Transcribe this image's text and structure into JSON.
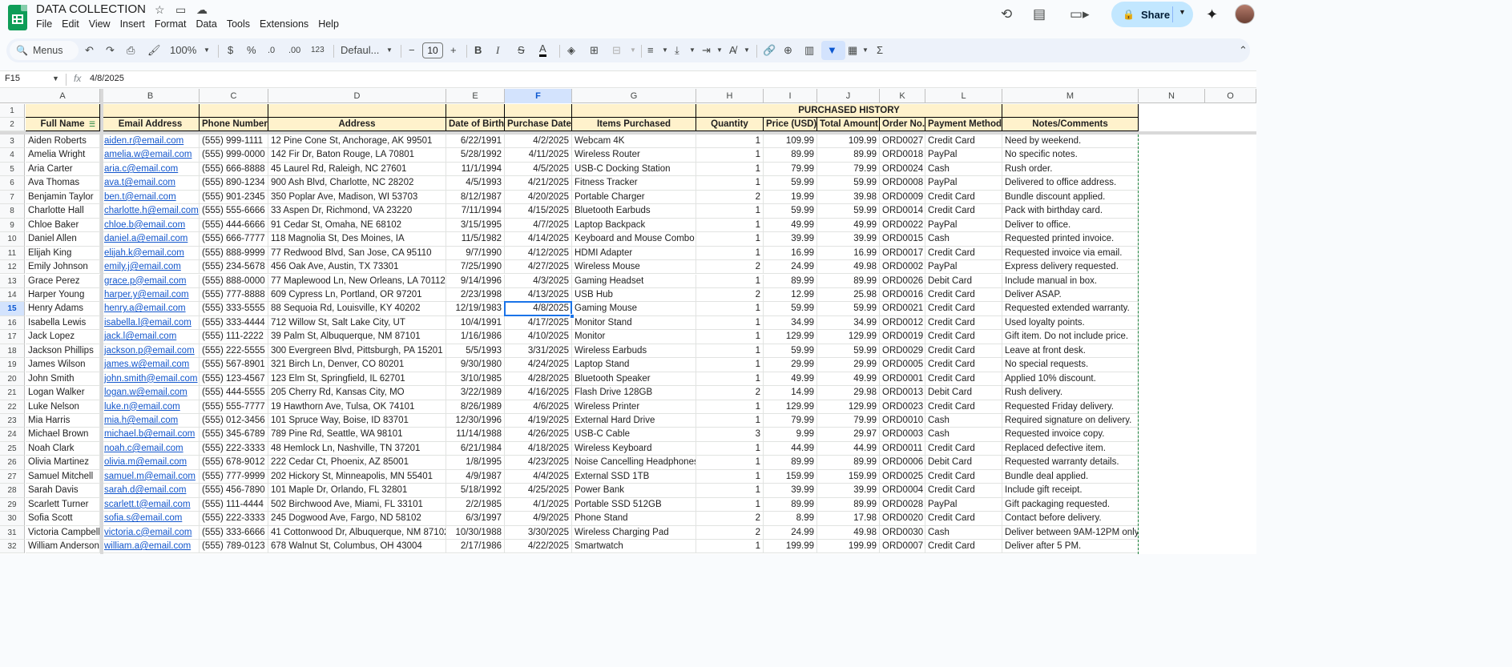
{
  "app": {
    "doc_title": "DATA COLLECTION",
    "menu": [
      "File",
      "Edit",
      "View",
      "Insert",
      "Format",
      "Data",
      "Tools",
      "Extensions",
      "Help"
    ],
    "share_label": "Share"
  },
  "toolbar": {
    "menus_label": "Menus",
    "zoom": "100%",
    "currency": "$",
    "percent": "%",
    "dec_less": ".0",
    "dec_more": ".00",
    "num_format": "123",
    "font": "Defaul...",
    "font_size": "10",
    "bold": "B",
    "italic": "I",
    "strike": "S",
    "text_color": "A"
  },
  "formula_bar": {
    "cell_ref": "F15",
    "fx": "fx",
    "value": "4/8/2025"
  },
  "columns": [
    "A",
    "B",
    "C",
    "D",
    "E",
    "F",
    "G",
    "H",
    "I",
    "J",
    "K",
    "L",
    "M",
    "N",
    "O"
  ],
  "selected_col": "F",
  "selected_row": 15,
  "section_title": "PURCHASED HISTORY",
  "headers": [
    "Full Name",
    "Email Address",
    "Phone Number",
    "Address",
    "Date of Birth",
    "Purchase Date",
    "Items Purchased",
    "Quantity",
    "Price (USD)",
    "Total Amount",
    "Order No.",
    "Payment Method",
    "Notes/Comments"
  ],
  "rows": [
    [
      "Aiden Roberts",
      "aiden.r@email.com",
      "(555) 999-1111",
      "12 Pine Cone St, Anchorage, AK 99501",
      "6/22/1991",
      "4/2/2025",
      "Webcam 4K",
      "1",
      "109.99",
      "109.99",
      "ORD0027",
      "Credit Card",
      "Need by weekend."
    ],
    [
      "Amelia Wright",
      "amelia.w@email.com",
      "(555) 999-0000",
      "142 Fir Dr, Baton Rouge, LA 70801",
      "5/28/1992",
      "4/11/2025",
      "Wireless Router",
      "1",
      "89.99",
      "89.99",
      "ORD0018",
      "PayPal",
      "No specific notes."
    ],
    [
      "Aria Carter",
      "aria.c@email.com",
      "(555) 666-8888",
      "45 Laurel Rd, Raleigh, NC 27601",
      "11/1/1994",
      "4/5/2025",
      "USB-C Docking Station",
      "1",
      "79.99",
      "79.99",
      "ORD0024",
      "Cash",
      "Rush order."
    ],
    [
      "Ava Thomas",
      "ava.t@email.com",
      "(555) 890-1234",
      "900 Ash Blvd, Charlotte, NC 28202",
      "4/5/1993",
      "4/21/2025",
      "Fitness Tracker",
      "1",
      "59.99",
      "59.99",
      "ORD0008",
      "PayPal",
      "Delivered to office address."
    ],
    [
      "Benjamin Taylor",
      "ben.t@email.com",
      "(555) 901-2345",
      "350 Poplar Ave, Madison, WI 53703",
      "8/12/1987",
      "4/20/2025",
      "Portable Charger",
      "2",
      "19.99",
      "39.98",
      "ORD0009",
      "Credit Card",
      "Bundle discount applied."
    ],
    [
      "Charlotte Hall",
      "charlotte.h@email.com",
      "(555) 555-6666",
      "33 Aspen Dr, Richmond, VA 23220",
      "7/11/1994",
      "4/15/2025",
      "Bluetooth Earbuds",
      "1",
      "59.99",
      "59.99",
      "ORD0014",
      "Credit Card",
      "Pack with birthday card."
    ],
    [
      "Chloe Baker",
      "chloe.b@email.com",
      "(555) 444-6666",
      "91 Cedar St, Omaha, NE 68102",
      "3/15/1995",
      "4/7/2025",
      "Laptop Backpack",
      "1",
      "49.99",
      "49.99",
      "ORD0022",
      "PayPal",
      "Deliver to office."
    ],
    [
      "Daniel Allen",
      "daniel.a@email.com",
      "(555) 666-7777",
      "118 Magnolia St, Des Moines, IA",
      "11/5/1982",
      "4/14/2025",
      "Keyboard and Mouse Combo",
      "1",
      "39.99",
      "39.99",
      "ORD0015",
      "Cash",
      "Requested printed invoice."
    ],
    [
      "Elijah King",
      "elijah.k@email.com",
      "(555) 888-9999",
      "77 Redwood Blvd, San Jose, CA 95110",
      "9/7/1990",
      "4/12/2025",
      "HDMI Adapter",
      "1",
      "16.99",
      "16.99",
      "ORD0017",
      "Credit Card",
      "Requested invoice via email."
    ],
    [
      "Emily Johnson",
      "emily.j@email.com",
      "(555) 234-5678",
      "456 Oak Ave, Austin, TX 73301",
      "7/25/1990",
      "4/27/2025",
      "Wireless Mouse",
      "2",
      "24.99",
      "49.98",
      "ORD0002",
      "PayPal",
      "Express delivery requested."
    ],
    [
      "Grace Perez",
      "grace.p@email.com",
      "(555) 888-0000",
      "77 Maplewood Ln, New Orleans, LA 70112",
      "9/14/1996",
      "4/3/2025",
      "Gaming Headset",
      "1",
      "89.99",
      "89.99",
      "ORD0026",
      "Debit Card",
      "Include manual in box."
    ],
    [
      "Harper Young",
      "harper.y@email.com",
      "(555) 777-8888",
      "609 Cypress Ln, Portland, OR 97201",
      "2/23/1998",
      "4/13/2025",
      "USB Hub",
      "2",
      "12.99",
      "25.98",
      "ORD0016",
      "Credit Card",
      "Deliver ASAP."
    ],
    [
      "Henry Adams",
      "henry.a@email.com",
      "(555) 333-5555",
      "88 Sequoia Rd, Louisville, KY 40202",
      "12/19/1983",
      "4/8/2025",
      "Gaming Mouse",
      "1",
      "59.99",
      "59.99",
      "ORD0021",
      "Credit Card",
      "Requested extended warranty."
    ],
    [
      "Isabella Lewis",
      "isabella.l@email.com",
      "(555) 333-4444",
      "712 Willow St, Salt Lake City, UT",
      "10/4/1991",
      "4/17/2025",
      "Monitor Stand",
      "1",
      "34.99",
      "34.99",
      "ORD0012",
      "Credit Card",
      "Used loyalty points."
    ],
    [
      "Jack Lopez",
      "jack.l@email.com",
      "(555) 111-2222",
      "39 Palm St, Albuquerque, NM 87101",
      "1/16/1986",
      "4/10/2025",
      "Monitor",
      "1",
      "129.99",
      "129.99",
      "ORD0019",
      "Credit Card",
      "Gift item. Do not include price."
    ],
    [
      "Jackson Phillips",
      "jackson.p@email.com",
      "(555) 222-5555",
      "300 Evergreen Blvd, Pittsburgh, PA 15201",
      "5/5/1993",
      "3/31/2025",
      "Wireless Earbuds",
      "1",
      "59.99",
      "59.99",
      "ORD0029",
      "Credit Card",
      "Leave at front desk."
    ],
    [
      "James Wilson",
      "james.w@email.com",
      "(555) 567-8901",
      "321 Birch Ln, Denver, CO 80201",
      "9/30/1980",
      "4/24/2025",
      "Laptop Stand",
      "1",
      "29.99",
      "29.99",
      "ORD0005",
      "Credit Card",
      "No special requests."
    ],
    [
      "John Smith",
      "john.smith@email.com",
      "(555) 123-4567",
      "123 Elm St, Springfield, IL 62701",
      "3/10/1985",
      "4/28/2025",
      "Bluetooth Speaker",
      "1",
      "49.99",
      "49.99",
      "ORD0001",
      "Credit Card",
      "Applied 10% discount."
    ],
    [
      "Logan Walker",
      "logan.w@email.com",
      "(555) 444-5555",
      "205 Cherry Rd, Kansas City, MO",
      "3/22/1989",
      "4/16/2025",
      "Flash Drive 128GB",
      "2",
      "14.99",
      "29.98",
      "ORD0013",
      "Debit Card",
      "Rush delivery."
    ],
    [
      "Luke Nelson",
      "luke.n@email.com",
      "(555) 555-7777",
      "19 Hawthorn Ave, Tulsa, OK 74101",
      "8/26/1989",
      "4/6/2025",
      "Wireless Printer",
      "1",
      "129.99",
      "129.99",
      "ORD0023",
      "Credit Card",
      "Requested Friday delivery."
    ],
    [
      "Mia Harris",
      "mia.h@email.com",
      "(555) 012-3456",
      "101 Spruce Way, Boise, ID 83701",
      "12/30/1996",
      "4/19/2025",
      "External Hard Drive",
      "1",
      "79.99",
      "79.99",
      "ORD0010",
      "Cash",
      "Required signature on delivery."
    ],
    [
      "Michael Brown",
      "michael.b@email.com",
      "(555) 345-6789",
      "789 Pine Rd, Seattle, WA 98101",
      "11/14/1988",
      "4/26/2025",
      "USB-C Cable",
      "3",
      "9.99",
      "29.97",
      "ORD0003",
      "Cash",
      "Requested invoice copy."
    ],
    [
      "Noah Clark",
      "noah.c@email.com",
      "(555) 222-3333",
      "48 Hemlock Ln, Nashville, TN 37201",
      "6/21/1984",
      "4/18/2025",
      "Wireless Keyboard",
      "1",
      "44.99",
      "44.99",
      "ORD0011",
      "Credit Card",
      "Replaced defective item."
    ],
    [
      "Olivia Martinez",
      "olivia.m@email.com",
      "(555) 678-9012",
      "222 Cedar Ct, Phoenix, AZ 85001",
      "1/8/1995",
      "4/23/2025",
      "Noise Cancelling Headphones",
      "1",
      "89.99",
      "89.99",
      "ORD0006",
      "Debit Card",
      "Requested warranty details."
    ],
    [
      "Samuel Mitchell",
      "samuel.m@email.com",
      "(555) 777-9999",
      "202 Hickory St, Minneapolis, MN 55401",
      "4/9/1987",
      "4/4/2025",
      "External SSD 1TB",
      "1",
      "159.99",
      "159.99",
      "ORD0025",
      "Credit Card",
      "Bundle deal applied."
    ],
    [
      "Sarah Davis",
      "sarah.d@email.com",
      "(555) 456-7890",
      "101 Maple Dr, Orlando, FL 32801",
      "5/18/1992",
      "4/25/2025",
      "Power Bank",
      "1",
      "39.99",
      "39.99",
      "ORD0004",
      "Credit Card",
      "Include gift receipt."
    ],
    [
      "Scarlett Turner",
      "scarlett.t@email.com",
      "(555) 111-4444",
      "502 Birchwood Ave, Miami, FL 33101",
      "2/2/1985",
      "4/1/2025",
      "Portable SSD 512GB",
      "1",
      "89.99",
      "89.99",
      "ORD0028",
      "PayPal",
      "Gift packaging requested."
    ],
    [
      "Sofia Scott",
      "sofia.s@email.com",
      "(555) 222-3333",
      "245 Dogwood Ave, Fargo, ND 58102",
      "6/3/1997",
      "4/9/2025",
      "Phone Stand",
      "2",
      "8.99",
      "17.98",
      "ORD0020",
      "Credit Card",
      "Contact before delivery."
    ],
    [
      "Victoria Campbell",
      "victoria.c@email.com",
      "(555) 333-6666",
      "41 Cottonwood Dr, Albuquerque, NM 87102",
      "10/30/1988",
      "3/30/2025",
      "Wireless Charging Pad",
      "2",
      "24.99",
      "49.98",
      "ORD0030",
      "Cash",
      "Deliver between 9AM-12PM only."
    ],
    [
      "William Anderson",
      "william.a@email.com",
      "(555) 789-0123",
      "678 Walnut St, Columbus, OH 43004",
      "2/17/1986",
      "4/22/2025",
      "Smartwatch",
      "1",
      "199.99",
      "199.99",
      "ORD0007",
      "Credit Card",
      "Deliver after 5 PM."
    ]
  ]
}
